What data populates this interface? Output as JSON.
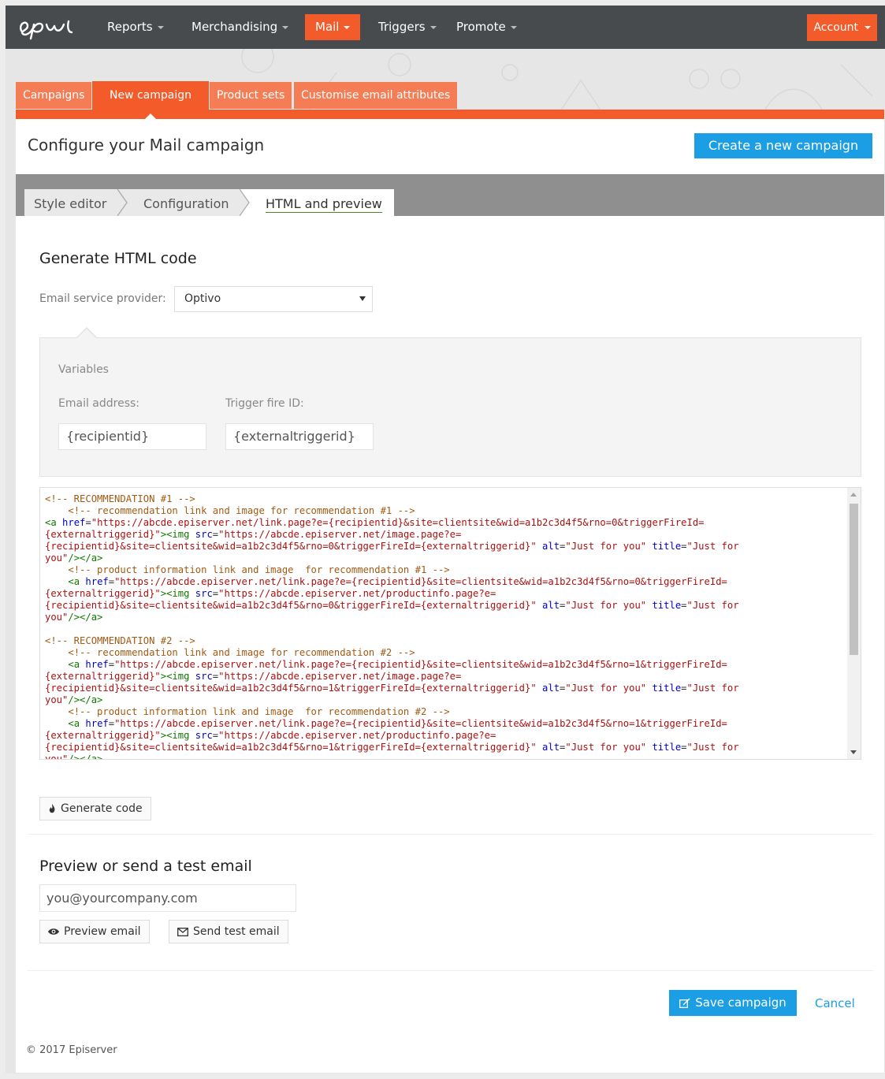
{
  "nav": {
    "items": [
      {
        "label": "Reports"
      },
      {
        "label": "Merchandising"
      },
      {
        "label": "Mail"
      },
      {
        "label": "Triggers"
      },
      {
        "label": "Promote"
      }
    ],
    "account_label": "Account"
  },
  "subtabs": [
    {
      "label": "Campaigns"
    },
    {
      "label": "New campaign"
    },
    {
      "label": "Product sets"
    },
    {
      "label": "Customise email attributes"
    }
  ],
  "header": {
    "title": "Configure your Mail campaign",
    "create_button": "Create a new campaign"
  },
  "wizard": {
    "steps": [
      {
        "label": "Style editor"
      },
      {
        "label": "Configuration"
      },
      {
        "label": "HTML and preview"
      }
    ]
  },
  "generate": {
    "heading": "Generate HTML code",
    "provider_label": "Email service provider:",
    "provider_value": "Optivo",
    "variables_heading": "Variables",
    "email_label": "Email address:",
    "email_value": "{recipientid}",
    "trigger_label": "Trigger fire ID:",
    "trigger_value": "{externaltriggerid}",
    "generate_button": "Generate code"
  },
  "preview": {
    "heading": "Preview or send a test email",
    "email_placeholder": "you@yourcompany.com",
    "preview_button": "Preview email",
    "send_button": "Send test email"
  },
  "actions": {
    "save_button": "Save campaign",
    "cancel_link": "Cancel"
  },
  "footer": {
    "copyright": "© 2017 Episerver"
  },
  "colors": {
    "nav_bg": "#474b4d",
    "accent": "#f35b2a",
    "primary": "#1b9ee3"
  }
}
